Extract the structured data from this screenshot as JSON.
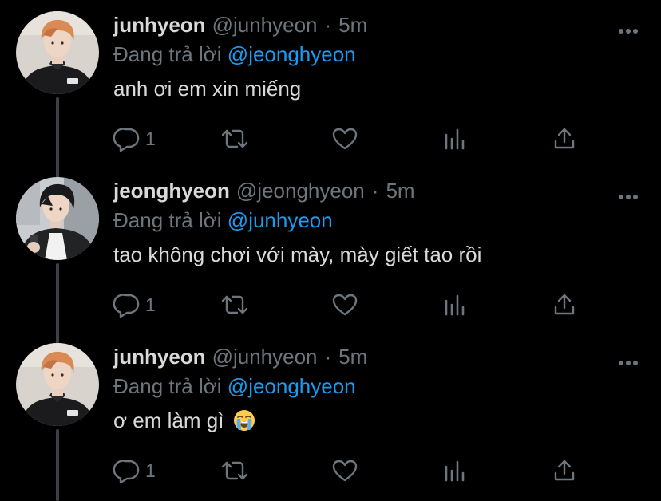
{
  "theme": {
    "background": "#000000",
    "text": "#d9d9d9",
    "muted": "#6e767d",
    "mention": "#1d9bf0",
    "thread_line": "#3d4145"
  },
  "tweets": [
    {
      "name": "junhyeon",
      "handle": "@junhyeon",
      "separator": "·",
      "time": "5m",
      "replying_prefix": "Đang trả lời",
      "replying_to": "@jeonghyeon",
      "text": "anh ơi em xin miếng",
      "reply_count": "1",
      "avatar_icon": "profile-photo-orange-hair-black-jacket"
    },
    {
      "name": "jeonghyeon",
      "handle": "@jeonghyeon",
      "separator": "·",
      "time": "5m",
      "replying_prefix": "Đang trả lời",
      "replying_to": "@junhyeon",
      "text": "tao không chơi với mày, mày giết tao rồi",
      "reply_count": "1",
      "avatar_icon": "profile-photo-dark-hair-holding-phone"
    },
    {
      "name": "junhyeon",
      "handle": "@junhyeon",
      "separator": "·",
      "time": "5m",
      "replying_prefix": "Đang trả lời",
      "replying_to": "@jeonghyeon",
      "text": "ơ em làm gì",
      "text_emoji": "loudly-crying-face",
      "reply_count": "1",
      "avatar_icon": "profile-photo-orange-hair-black-jacket"
    }
  ],
  "action_icons": [
    "reply-icon",
    "retweet-icon",
    "like-icon",
    "analytics-icon",
    "share-icon"
  ],
  "more_icon": "more-options-icon"
}
